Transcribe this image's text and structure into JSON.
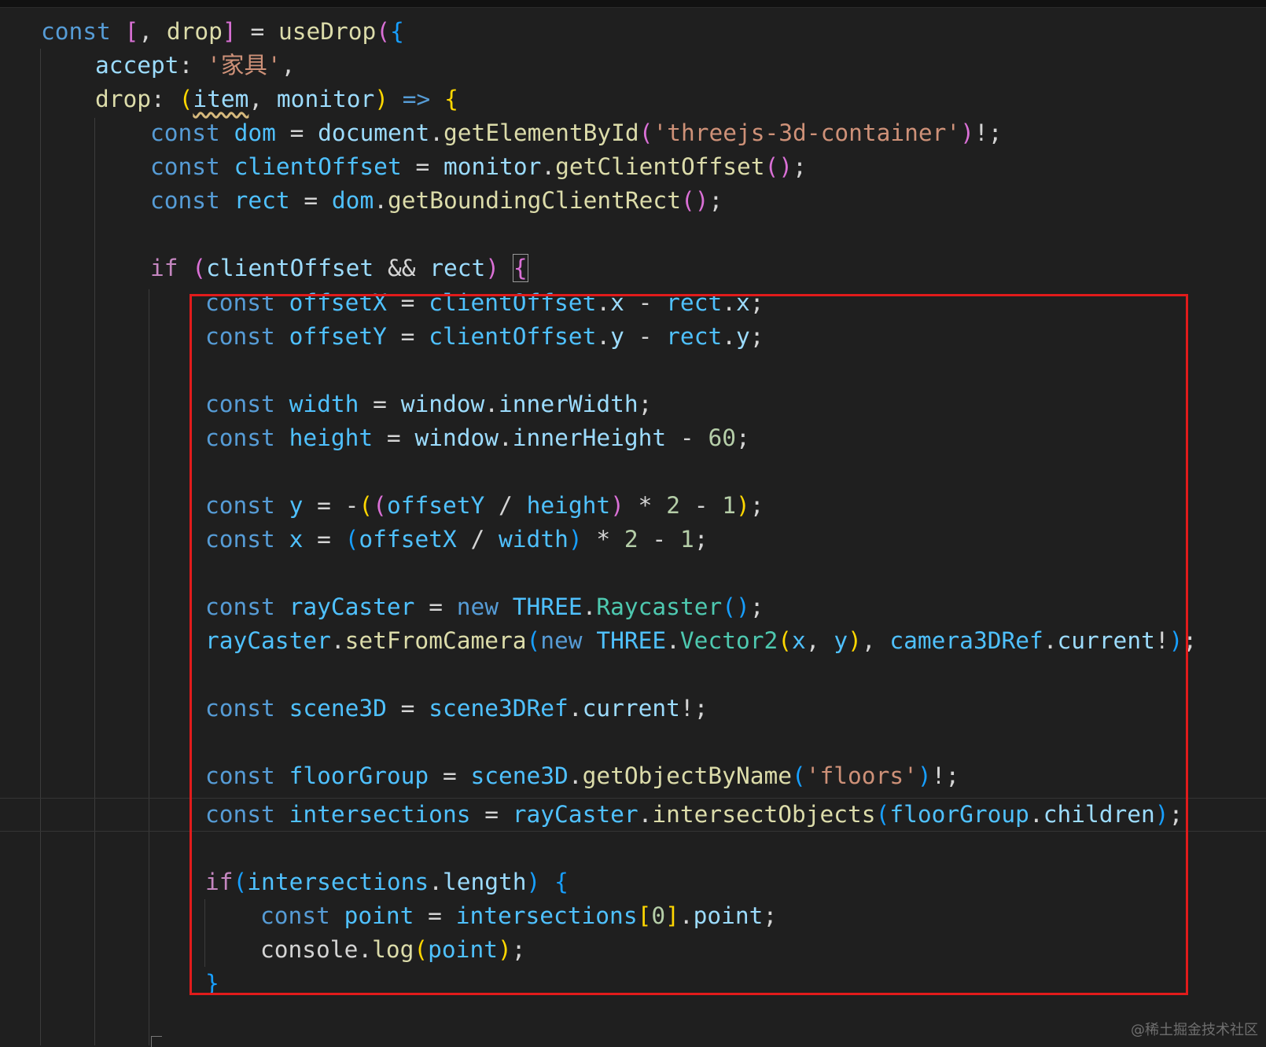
{
  "editor": {
    "lines": [
      [
        "const",
        " ",
        "[",
        ", ",
        "drop",
        "]",
        " = ",
        "useDrop",
        "(",
        "{"
      ],
      [
        "accept",
        ": ",
        "'家具'",
        ","
      ],
      [
        "drop",
        ": ",
        "(",
        "item",
        ", ",
        "monitor",
        ")",
        " => ",
        "{"
      ],
      [
        "const",
        " ",
        "dom",
        " = ",
        "document",
        ".",
        "getElementById",
        "(",
        "'threejs-3d-container'",
        ")",
        "!;"
      ],
      [
        "const",
        " ",
        "clientOffset",
        " = ",
        "monitor",
        ".",
        "getClientOffset",
        "(",
        ")",
        ";"
      ],
      [
        "const",
        " ",
        "rect",
        " = ",
        "dom",
        ".",
        "getBoundingClientRect",
        "(",
        ")",
        ";"
      ],
      [],
      [
        "if",
        " ",
        "(",
        "clientOffset",
        " && ",
        "rect",
        ")",
        " ",
        "{"
      ],
      [
        "const",
        " ",
        "offsetX",
        " = ",
        "clientOffset",
        ".",
        "x",
        " - ",
        "rect",
        ".",
        "x",
        ";"
      ],
      [
        "const",
        " ",
        "offsetY",
        " = ",
        "clientOffset",
        ".",
        "y",
        " - ",
        "rect",
        ".",
        "y",
        ";"
      ],
      [],
      [
        "const",
        " ",
        "width",
        " = ",
        "window",
        ".",
        "innerWidth",
        ";"
      ],
      [
        "const",
        " ",
        "height",
        " = ",
        "window",
        ".",
        "innerHeight",
        " - ",
        "60",
        ";"
      ],
      [],
      [
        "const",
        " ",
        "y",
        " = ",
        "-",
        "(",
        "(",
        "offsetY",
        " / ",
        "height",
        ")",
        " * ",
        "2",
        " - ",
        "1",
        ")",
        ";"
      ],
      [
        "const",
        " ",
        "x",
        " = ",
        "(",
        "offsetX",
        " / ",
        "width",
        ")",
        " * ",
        "2",
        " - ",
        "1",
        ";"
      ],
      [],
      [
        "const",
        " ",
        "rayCaster",
        " = ",
        "new",
        " ",
        "THREE",
        ".",
        "Raycaster",
        "(",
        ")",
        ";"
      ],
      [
        "rayCaster",
        ".",
        "setFromCamera",
        "(",
        "new",
        " ",
        "THREE",
        ".",
        "Vector2",
        "(",
        "x",
        ", ",
        "y",
        ")",
        ", ",
        "camera3DRef",
        ".",
        "current",
        "!",
        ")",
        ";"
      ],
      [],
      [
        "const",
        " ",
        "scene3D",
        " = ",
        "scene3DRef",
        ".",
        "current",
        "!;"
      ],
      [],
      [
        "const",
        " ",
        "floorGroup",
        " = ",
        "scene3D",
        ".",
        "getObjectByName",
        "(",
        "'floors'",
        ")",
        "!;"
      ],
      [
        "const",
        " ",
        "intersections",
        " = ",
        "rayCaster",
        ".",
        "intersectObjects",
        "(",
        "floorGroup",
        ".",
        "children",
        ")",
        ";"
      ],
      [],
      [
        "if",
        "(",
        "intersections",
        ".",
        "length",
        ")",
        " ",
        "{"
      ],
      [
        "const",
        " ",
        "point",
        " = ",
        "intersections",
        "[",
        "0",
        "]",
        ".",
        "point",
        ";"
      ],
      [
        "console",
        ".",
        "log",
        "(",
        "point",
        ")",
        ";"
      ],
      [
        "}"
      ]
    ]
  },
  "watermark": "@稀土掘金技术社区",
  "colors": {
    "background": "#1f1f1f",
    "highlight_box": "#e11b1b"
  }
}
